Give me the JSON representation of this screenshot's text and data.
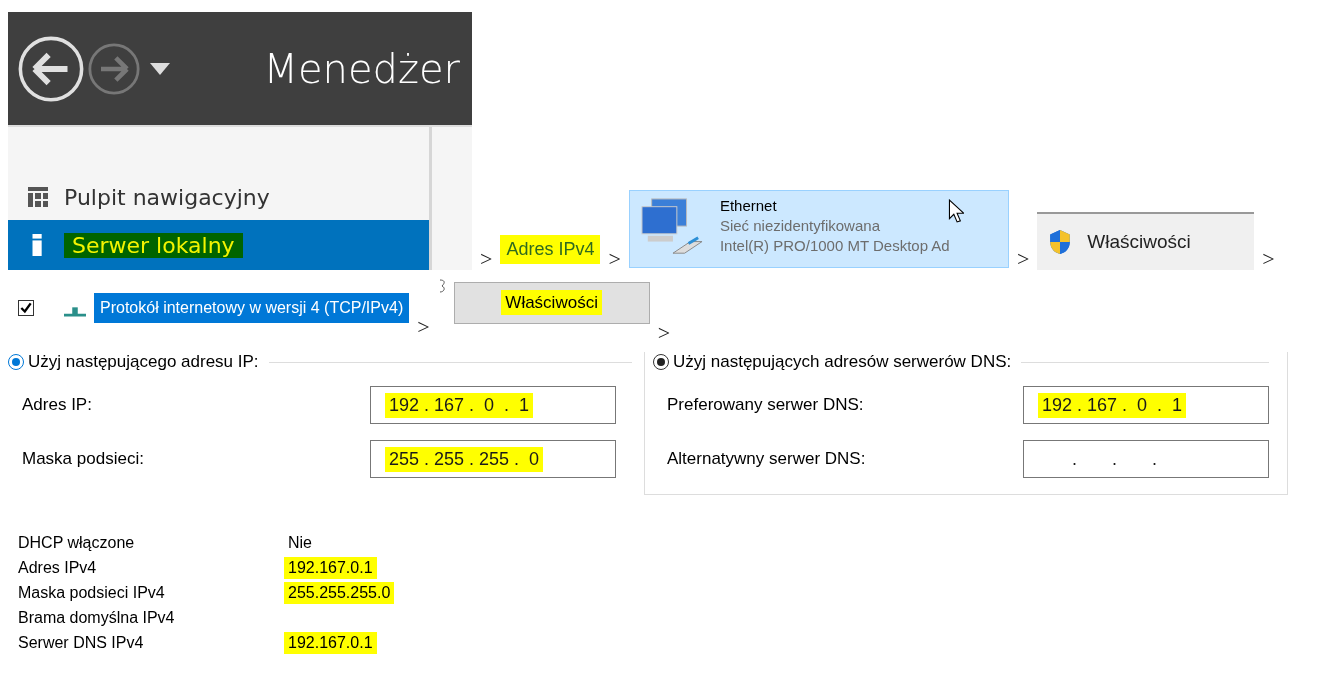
{
  "server_manager": {
    "title": "Menedżer",
    "nav": [
      {
        "label": "Pulpit nawigacyjny",
        "kind": "dashboard",
        "selected": false,
        "highlighted": false
      },
      {
        "label": "Serwer lokalny",
        "kind": "server",
        "selected": true,
        "highlighted": true
      }
    ]
  },
  "separators": [
    ">",
    ">",
    ">",
    ">",
    ">",
    ">"
  ],
  "step_label": {
    "label": "Adres IPv4",
    "highlighted": true
  },
  "adapter": {
    "name": "Ethernet",
    "status": "Sieć niezidentyfikowana",
    "device": "Intel(R) PRO/1000 MT Desktop Ad",
    "selected": true
  },
  "properties_button_1": {
    "label": "Właściwości",
    "highlighted": false
  },
  "protocol": {
    "label": "Protokół internetowy w wersji 4 (TCP/IPv4)",
    "checked": true,
    "selected": true
  },
  "properties_button_2": {
    "label": "Właściwości",
    "highlighted": true
  },
  "ip_group": {
    "label": "Użyj następującego adresu IP:",
    "selected": true,
    "fields": [
      {
        "label": "Adres IP:",
        "value": "192 . 167 .  0  .  1",
        "highlighted": true
      },
      {
        "label": "Maska podsieci:",
        "value": "255 . 255 . 255 .  0",
        "highlighted": true
      }
    ]
  },
  "dns_group": {
    "label": "Użyj następujących adresów serwerów DNS:",
    "selected": true,
    "fields": [
      {
        "label": "Preferowany serwer DNS:",
        "value": "192 . 167 .  0  .  1",
        "highlighted": true
      },
      {
        "label": "Alternatywny serwer DNS:",
        "value": "      .       .       .",
        "highlighted": false
      }
    ]
  },
  "details": [
    {
      "label": "DHCP włączone",
      "value": "Nie"
    },
    {
      "label": "Adres IPv4",
      "value": "192.167.0.1",
      "highlighted": true
    },
    {
      "label": "Maska podsieci IPv4",
      "value": "255.255.255.0",
      "highlighted": true
    },
    {
      "label": "Brama domyślna IPv4"
    },
    {
      "label": "Serwer DNS IPv4",
      "value": "192.167.0.1",
      "highlighted": true
    }
  ]
}
